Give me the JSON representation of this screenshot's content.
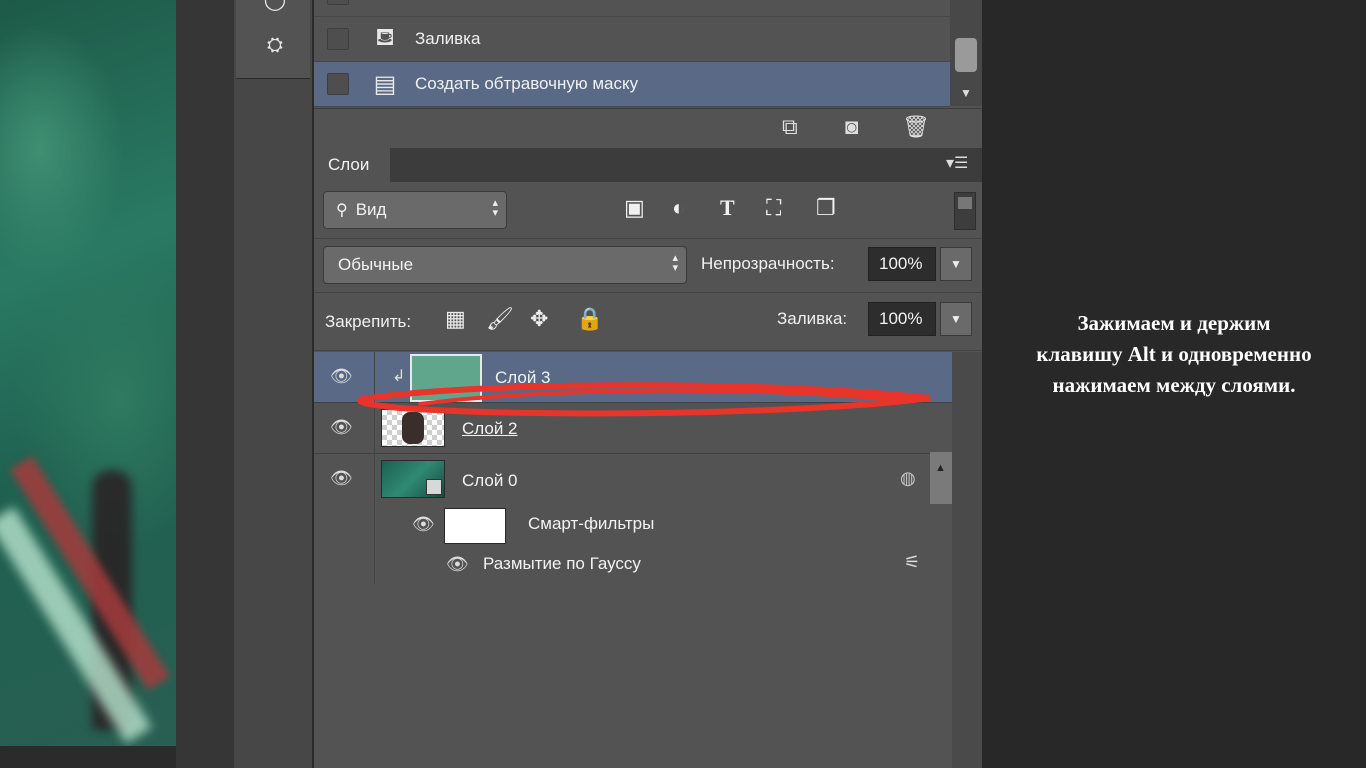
{
  "history": {
    "items": [
      {
        "label": "Заливка",
        "icon": "paint-bucket-icon"
      },
      {
        "label": "Создать обтравочную маску",
        "icon": "document-icon",
        "selected": true
      }
    ],
    "footer_icons": [
      "new-document-from-state-icon",
      "camera-icon",
      "trash-icon"
    ]
  },
  "layers_panel": {
    "tab": "Слои",
    "filter": {
      "label": "Вид"
    },
    "filter_icons": [
      "image-filter-icon",
      "adjustment-filter-icon",
      "type-filter-icon",
      "shape-filter-icon",
      "smart-object-filter-icon"
    ],
    "blend_mode": "Обычные",
    "opacity_label": "Непрозрачность:",
    "opacity_value": "100%",
    "lock_label": "Закрепить:",
    "lock_icons": [
      "lock-transparent-icon",
      "lock-brush-icon",
      "lock-move-icon",
      "lock-all-icon"
    ],
    "fill_label": "Заливка:",
    "fill_value": "100%",
    "layers": [
      {
        "name": "Слой 3",
        "selected": true,
        "clipped": true
      },
      {
        "name": "Слой 2"
      },
      {
        "name": "Слой 0",
        "smart_object": true
      },
      {
        "name": "Смарт-фильтры",
        "sub": true
      },
      {
        "name": "Размытие по Гауссу",
        "sub": true
      }
    ]
  },
  "caption": {
    "line1": "Зажимаем и держим",
    "line2": "клавишу Alt и одновременно",
    "line3": "нажимаем между слоями."
  },
  "colors": {
    "selection": "#5a6a86",
    "annotation": "#e8342a",
    "swatch": "#5fa68d"
  }
}
